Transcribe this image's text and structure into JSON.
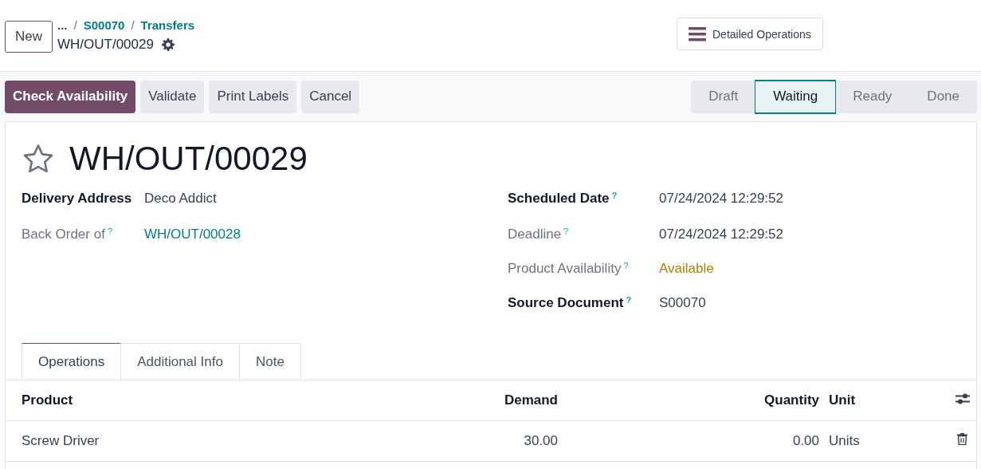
{
  "header": {
    "new_button": "New",
    "breadcrumbs": [
      {
        "label": "..."
      },
      {
        "label": "S00070"
      },
      {
        "label": "Transfers"
      }
    ],
    "separators": [
      "/",
      "/"
    ],
    "record": "WH/OUT/00029",
    "detailed_button": "Detailed Operations"
  },
  "actions": [
    {
      "label": "Check Availability",
      "primary": true
    },
    {
      "label": "Validate",
      "primary": false
    },
    {
      "label": "Print Labels",
      "primary": false
    },
    {
      "label": "Cancel",
      "primary": false
    }
  ],
  "stages": [
    {
      "label": "Draft",
      "selected": false
    },
    {
      "label": "Waiting",
      "selected": true
    },
    {
      "label": "Ready",
      "selected": false
    },
    {
      "label": "Done",
      "selected": false
    }
  ],
  "title": {
    "text": "WH/OUT/00029",
    "starred": false
  },
  "left_fields": [
    {
      "label": "Delivery Address",
      "bold": true,
      "value": "Deco Addict",
      "kind": "text"
    },
    {
      "label": "Back Order of",
      "bold": false,
      "help": "?",
      "value": "WH/OUT/00028",
      "kind": "link"
    }
  ],
  "right_fields": [
    {
      "label": "Scheduled Date",
      "bold": true,
      "help": "?",
      "value": "07/24/2024 12:29:52",
      "kind": "text"
    },
    {
      "label": "Deadline",
      "bold": false,
      "help": "?",
      "value": "07/24/2024 12:29:52",
      "kind": "text"
    },
    {
      "label": "Product Availability",
      "bold": false,
      "help": "?",
      "value": "Available",
      "kind": "warning"
    },
    {
      "label": "Source Document",
      "bold": true,
      "help": "?",
      "value": "S00070",
      "kind": "text"
    }
  ],
  "tabs": [
    {
      "label": "Operations",
      "selected": true
    },
    {
      "label": "Additional Info",
      "selected": false
    },
    {
      "label": "Note",
      "selected": false
    }
  ],
  "table": {
    "columns": [
      "Product",
      "Demand",
      "Quantity",
      "Unit"
    ],
    "rows": [
      {
        "product": "Screw Driver",
        "demand": "30.00",
        "quantity": "0.00",
        "unit": "Units"
      }
    ]
  }
}
